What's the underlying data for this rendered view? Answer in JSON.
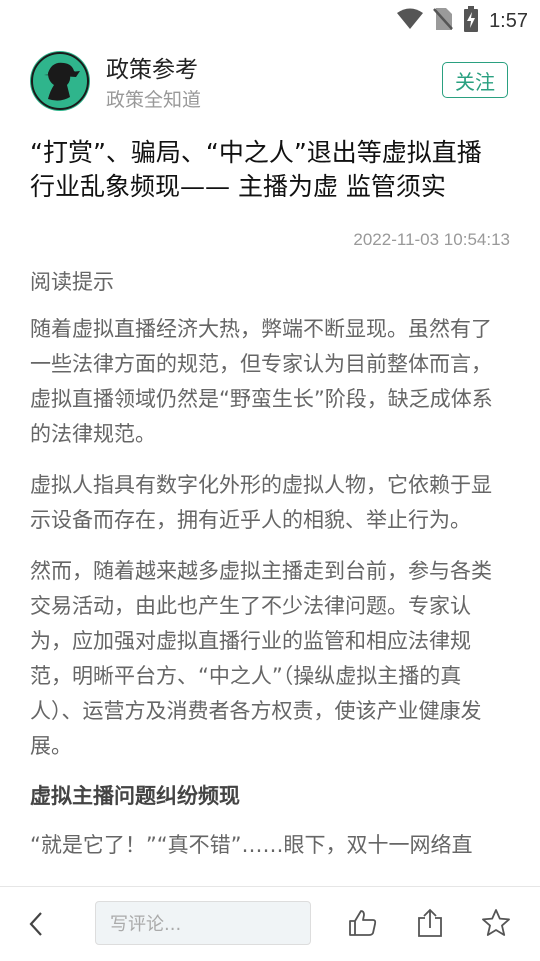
{
  "status_bar": {
    "time": "1:57"
  },
  "header": {
    "source_name": "政策参考",
    "source_subtitle": "政策全知道",
    "follow_label": "关注"
  },
  "article": {
    "title_line1": "“打赏”、骗局、“中之人”退出等虚拟直播",
    "title_line2": "行业乱象频现—— 主播为虚 监管须实",
    "datetime": "2022-11-03 10:54:13",
    "hint_label": "阅读提示",
    "paragraphs": [
      "随着虚拟直播经济大热，弊端不断显现。虽然有了一些法律方面的规范，但专家认为目前整体而言，虚拟直播领域仍然是“野蛮生长”阶段，缺乏成体系的法律规范。",
      "虚拟人指具有数字化外形的虚拟人物，它依赖于显示设备而存在，拥有近乎人的相貌、举止行为。",
      "然而，随着越来越多虚拟主播走到台前，参与各类交易活动，由此也产生了不少法律问题。专家认为，应加强对虚拟直播行业的监管和相应法律规范，明晰平台方、“中之人”（操纵虚拟主播的真人）、运营方及消费者各方权责，使该产业健康发展。"
    ],
    "subheading": "虚拟主播问题纠纷频现",
    "last_paragraph": "“就是它了！”“真不错”……眼下，双十一网络直"
  },
  "bottom_bar": {
    "comment_placeholder": "写评论...",
    "icons": [
      "back-icon",
      "thumbs-up-icon",
      "share-icon",
      "star-icon"
    ]
  },
  "colors": {
    "accent": "#2aa080",
    "avatar_bg": "#2fb58c",
    "text_gray": "#666666"
  }
}
